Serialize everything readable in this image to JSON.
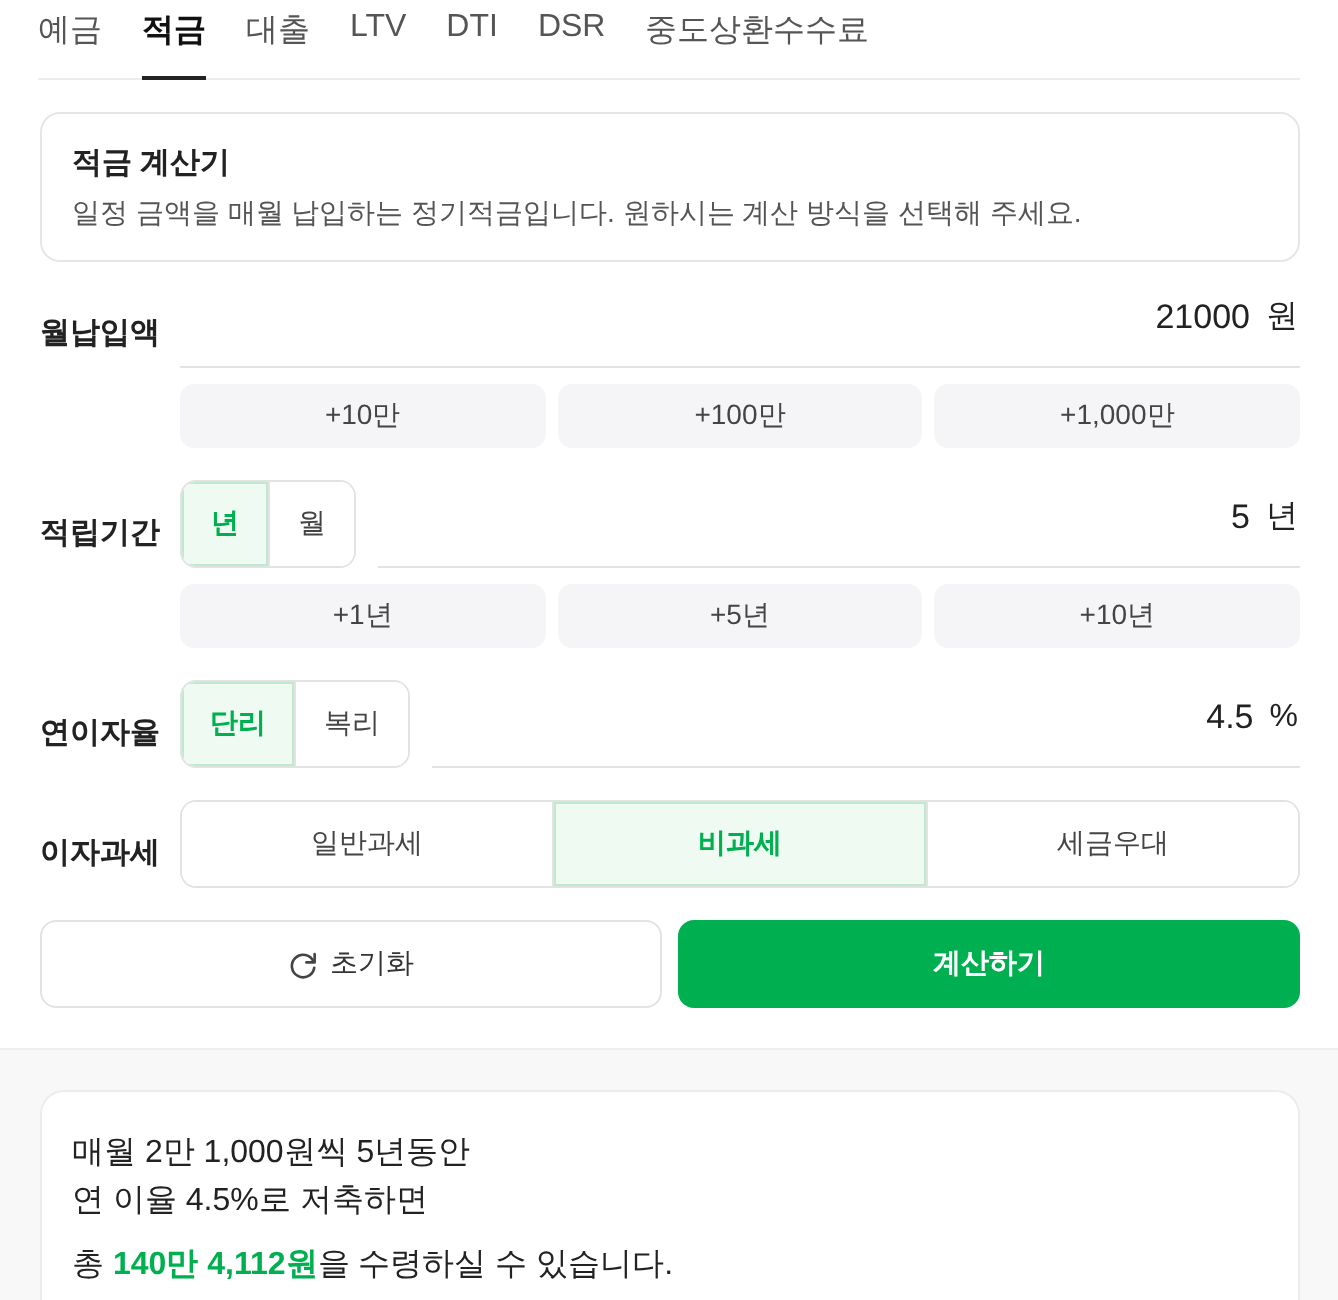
{
  "tabs": [
    {
      "label": "예금",
      "selected": false
    },
    {
      "label": "적금",
      "selected": true
    },
    {
      "label": "대출",
      "selected": false
    },
    {
      "label": "LTV",
      "selected": false
    },
    {
      "label": "DTI",
      "selected": false
    },
    {
      "label": "DSR",
      "selected": false
    },
    {
      "label": "중도상환수수료",
      "selected": false
    }
  ],
  "intro": {
    "title": "적금 계산기",
    "description": "일정 금액을 매월 납입하는 정기적금입니다. 원하시는 계산 방식을 선택해 주세요."
  },
  "fields": [
    {
      "kind": "input",
      "label": "월납입액",
      "value": "21000",
      "unit": "원",
      "quick_buttons": [
        "+10만",
        "+100만",
        "+1,000만"
      ]
    },
    {
      "kind": "input",
      "label": "적립기간",
      "options": [
        {
          "label": "년",
          "selected": true
        },
        {
          "label": "월",
          "selected": false
        }
      ],
      "value": "5",
      "unit": "년",
      "quick_buttons": [
        "+1년",
        "+5년",
        "+10년"
      ]
    },
    {
      "kind": "input",
      "label": "연이자율",
      "options": [
        {
          "label": "단리",
          "selected": true
        },
        {
          "label": "복리",
          "selected": false
        }
      ],
      "value": "4.5",
      "unit": "%"
    },
    {
      "kind": "choice",
      "label": "이자과세",
      "options": [
        {
          "label": "일반과세",
          "selected": false
        },
        {
          "label": "비과세",
          "selected": true
        },
        {
          "label": "세금우대",
          "selected": false
        }
      ]
    }
  ],
  "actions": [
    {
      "kind": "reset",
      "label": "초기화"
    },
    {
      "kind": "primary",
      "label": "계산하기"
    }
  ],
  "result": {
    "lines": [
      "매월 2만 1,000원씩 5년동안",
      "연 이율 4.5%로 저축하면"
    ],
    "summary": "총 **140만 4,112원**을 수령하실 수 있습니다."
  }
}
